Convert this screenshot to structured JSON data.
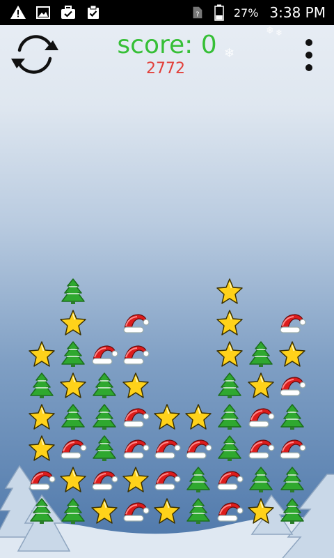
{
  "status_bar": {
    "battery_percent": "27%",
    "time": "3:38 PM",
    "left_icons": [
      "warning-icon",
      "image-icon",
      "briefcase-check-icon",
      "clipboard-check-icon"
    ],
    "right_icons": [
      "no-sim-icon",
      "battery-icon"
    ]
  },
  "header": {
    "score_text": "score: 0",
    "target_text": "2772",
    "restart_icon": "refresh-icon",
    "menu_icon": "more-vertical-icon"
  },
  "colors": {
    "score": "#36bf36",
    "target": "#e2403a",
    "tree": "#2fa82f",
    "star": "#ffd21a",
    "hat": "#dd1c1c"
  },
  "board": {
    "columns": 9,
    "rows": 8,
    "legend": {
      "T": "tree",
      "S": "star",
      "H": "santa-hat",
      ".": "empty"
    },
    "grid": [
      ". T . . . . S . .",
      ". S . H . . S . H",
      "S T H H . . S T S",
      "T S T S . . T S H",
      "S T T H S S T H T",
      "S H T H H H T H H",
      "H S H S H T H T T",
      "T T S H S T H S T"
    ]
  }
}
